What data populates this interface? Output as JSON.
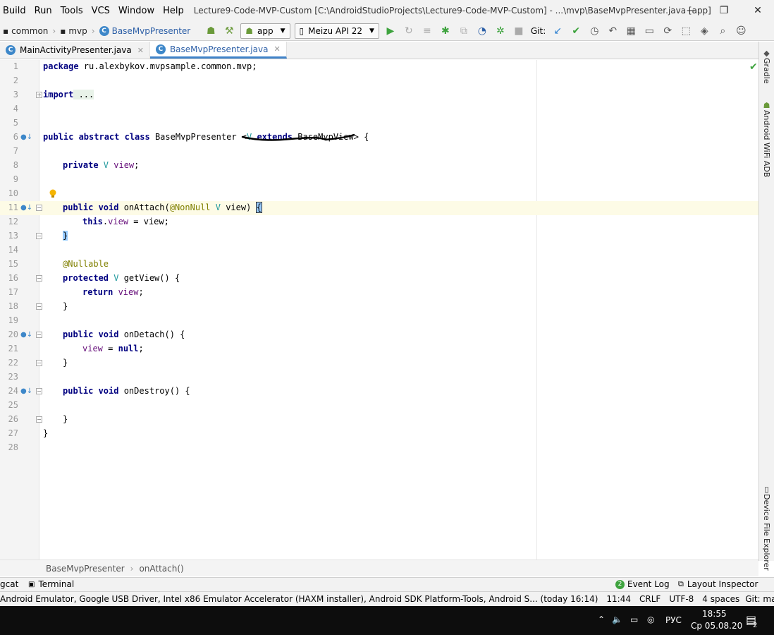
{
  "menu": [
    "Build",
    "Run",
    "Tools",
    "VCS",
    "Window",
    "Help"
  ],
  "window_title": "Lecture9-Code-MVP-Custom [C:\\AndroidStudioProjects\\Lecture9-Code-MVP-Custom] - ...\\mvp\\BaseMvpPresenter.java [app]",
  "window_controls": {
    "minimize": "—",
    "maximize": "❐",
    "close": "✕"
  },
  "nav": {
    "crumbs": [
      "common",
      "mvp"
    ],
    "class_crumb": "BaseMvpPresenter"
  },
  "run_config": "app",
  "device": "Meizu API 22",
  "git_label": "Git:",
  "tabs": [
    {
      "label": "MainActivityPresenter.java",
      "active": false
    },
    {
      "label": "BaseMvpPresenter.java",
      "active": true
    }
  ],
  "side_panels": [
    "Gradle",
    "Android WiFi ADB",
    "Device File Explorer"
  ],
  "code": {
    "line_numbers": [
      "1",
      "2",
      "3",
      "4",
      "5",
      "6",
      "7",
      "8",
      "9",
      "10",
      "11",
      "12",
      "13",
      "14",
      "15",
      "16",
      "17",
      "18",
      "19",
      "20",
      "21",
      "22",
      "23",
      "24",
      "25",
      "26",
      "27",
      "28"
    ],
    "l1_kw": "package",
    "l1_rest": " ru.alexbykov.mvpsample.common.mvp;",
    "l3_kw": "import",
    "l3_fold": " ...",
    "l6_kw": "public abstract class",
    "l6_name": " BaseMvpPresenter <",
    "l6_tp": "V",
    "l6_kw2": " extends",
    "l6_rest": " BaseMvpView> {",
    "l8_kw": "private",
    "l8_tp": " V",
    "l8_fld": " view",
    ";": ";",
    "l11_kw": "public void",
    "l11_name": " onAttach(",
    "l11_ann": "@NonNull",
    "l11_tp": " V",
    "l11_rest": " view) ",
    "l11_brace": "{",
    "l12_kw": "this",
    "l12_dot": ".",
    "l12_fld": "view",
    "l12_rest": " = view;",
    "l13_brace": "}",
    "l15_ann": "@Nullable",
    "l16_kw": "protected",
    "l16_tp": " V",
    "l16_rest": " getView() {",
    "l17_kw": "return",
    "l17_fld": " view",
    "l18": "}",
    "l20_kw": "public void",
    "l20_rest": " onDetach() {",
    "l21_fld": "view",
    "l21_rest": " = ",
    "l21_kw": "null",
    "l22": "}",
    "l24_kw": "public void",
    "l24_rest": " onDestroy() {",
    "l26": "}",
    "l27": "}"
  },
  "breadcrumb": [
    "BaseMvpPresenter",
    "onAttach()"
  ],
  "bottom_tools": {
    "logcat": "gcat",
    "terminal": "Terminal",
    "event_log": "Event Log",
    "event_count": "2",
    "layout_inspector": "Layout Inspector"
  },
  "status": {
    "message": "Android Emulator, Google USB Driver, Intel x86 Emulator Accelerator (HAXM installer), Android SDK Platform-Tools, Android S... (today 16:14)",
    "position": "11:44",
    "line_sep": "CRLF",
    "encoding": "UTF-8",
    "indent": "4 spaces",
    "vcs": "Git: master"
  },
  "taskbar": {
    "lang": "РУС",
    "time": "18:55",
    "date": "Ср 05.08.20",
    "notif": "2"
  }
}
